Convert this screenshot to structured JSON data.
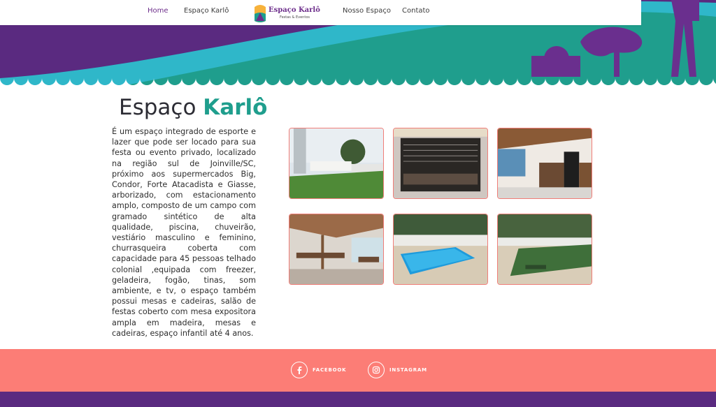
{
  "nav": {
    "home": "Home",
    "espaco_karlo": "Espaço Karlô",
    "nosso_espaco": "Nosso Espaço",
    "contato": "Contato"
  },
  "logo": {
    "title": "Espaço Karlô",
    "subtitle": "Festas & Eventos"
  },
  "main": {
    "title_part1": "Espaço",
    "title_part2": "Karlô",
    "description": "É um espaço integrado de esporte e lazer que pode ser locado para sua festa ou evento privado, localizado na região sul de Joinville/SC, próximo aos supermercados Big, Condor, Forte Atacadista e Giasse, arborizado, com estacionamento amplo, composto de um campo com gramado sintético de alta qualidade, piscina, chuveirão, vestiário masculino e feminino, churrasqueira coberta com capacidade para 45 pessoas telhado colonial ,equipada com freezer, geladeira, fogão, tinas, som ambiente, e tv, o espaço também possui mesas e cadeiras, salão de festas coberto com mesa expositora ampla em madeira, mesas e cadeiras, espaço infantil até 4 anos."
  },
  "gallery": [
    {
      "subject": "gramado"
    },
    {
      "subject": "churrasqueira"
    },
    {
      "subject": "cozinha"
    },
    {
      "subject": "salao"
    },
    {
      "subject": "piscina"
    },
    {
      "subject": "quadra"
    }
  ],
  "footer": {
    "facebook": "FACEBOOK",
    "instagram": "INSTAGRAM"
  },
  "colors": {
    "purple": "#5a2a80",
    "teal": "#1f9e8d",
    "coral": "#fc7d76",
    "title_accent": "#1f9e8d"
  }
}
